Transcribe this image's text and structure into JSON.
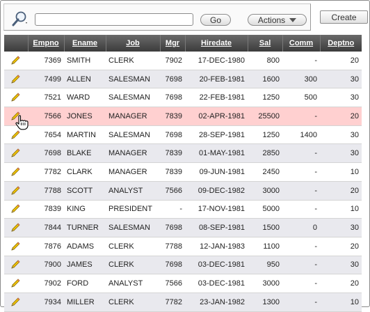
{
  "toolbar": {
    "search_value": "",
    "go_label": "Go",
    "actions_label": "Actions",
    "create_label": "Create"
  },
  "columns": [
    "",
    "Empno",
    "Ename",
    "Job",
    "Mgr",
    "Hiredate",
    "Sal",
    "Comm",
    "Deptno"
  ],
  "rows": [
    {
      "empno": "7369",
      "ename": "SMITH",
      "job": "CLERK",
      "mgr": "7902",
      "hiredate": "17-DEC-1980",
      "sal": "800",
      "comm": "-",
      "deptno": "20"
    },
    {
      "empno": "7499",
      "ename": "ALLEN",
      "job": "SALESMAN",
      "mgr": "7698",
      "hiredate": "20-FEB-1981",
      "sal": "1600",
      "comm": "300",
      "deptno": "30"
    },
    {
      "empno": "7521",
      "ename": "WARD",
      "job": "SALESMAN",
      "mgr": "7698",
      "hiredate": "22-FEB-1981",
      "sal": "1250",
      "comm": "500",
      "deptno": "30"
    },
    {
      "empno": "7566",
      "ename": "JONES",
      "job": "MANAGER",
      "mgr": "7839",
      "hiredate": "02-APR-1981",
      "sal": "25500",
      "comm": "-",
      "deptno": "20",
      "highlighted": true
    },
    {
      "empno": "7654",
      "ename": "MARTIN",
      "job": "SALESMAN",
      "mgr": "7698",
      "hiredate": "28-SEP-1981",
      "sal": "1250",
      "comm": "1400",
      "deptno": "30"
    },
    {
      "empno": "7698",
      "ename": "BLAKE",
      "job": "MANAGER",
      "mgr": "7839",
      "hiredate": "01-MAY-1981",
      "sal": "2850",
      "comm": "-",
      "deptno": "30"
    },
    {
      "empno": "7782",
      "ename": "CLARK",
      "job": "MANAGER",
      "mgr": "7839",
      "hiredate": "09-JUN-1981",
      "sal": "2450",
      "comm": "-",
      "deptno": "10"
    },
    {
      "empno": "7788",
      "ename": "SCOTT",
      "job": "ANALYST",
      "mgr": "7566",
      "hiredate": "09-DEC-1982",
      "sal": "3000",
      "comm": "-",
      "deptno": "20"
    },
    {
      "empno": "7839",
      "ename": "KING",
      "job": "PRESIDENT",
      "mgr": "-",
      "hiredate": "17-NOV-1981",
      "sal": "5000",
      "comm": "-",
      "deptno": "10"
    },
    {
      "empno": "7844",
      "ename": "TURNER",
      "job": "SALESMAN",
      "mgr": "7698",
      "hiredate": "08-SEP-1981",
      "sal": "1500",
      "comm": "0",
      "deptno": "30"
    },
    {
      "empno": "7876",
      "ename": "ADAMS",
      "job": "CLERK",
      "mgr": "7788",
      "hiredate": "12-JAN-1983",
      "sal": "1100",
      "comm": "-",
      "deptno": "20"
    },
    {
      "empno": "7900",
      "ename": "JAMES",
      "job": "CLERK",
      "mgr": "7698",
      "hiredate": "03-DEC-1981",
      "sal": "950",
      "comm": "-",
      "deptno": "30"
    },
    {
      "empno": "7902",
      "ename": "FORD",
      "job": "ANALYST",
      "mgr": "7566",
      "hiredate": "03-DEC-1981",
      "sal": "3000",
      "comm": "-",
      "deptno": "20"
    },
    {
      "empno": "7934",
      "ename": "MILLER",
      "job": "CLERK",
      "mgr": "7782",
      "hiredate": "23-JAN-1982",
      "sal": "1300",
      "comm": "-",
      "deptno": "10"
    }
  ],
  "icons": {
    "search": "magnifier-icon",
    "row_edit": "pencil-icon",
    "actions_menu": "chevron-down-icon",
    "cursor": "hand-pointer-icon"
  },
  "colors": {
    "header_bg": "#4a4a4a",
    "row_alt": "#e9e9ee",
    "row_highlight": "#ffd0d0"
  }
}
